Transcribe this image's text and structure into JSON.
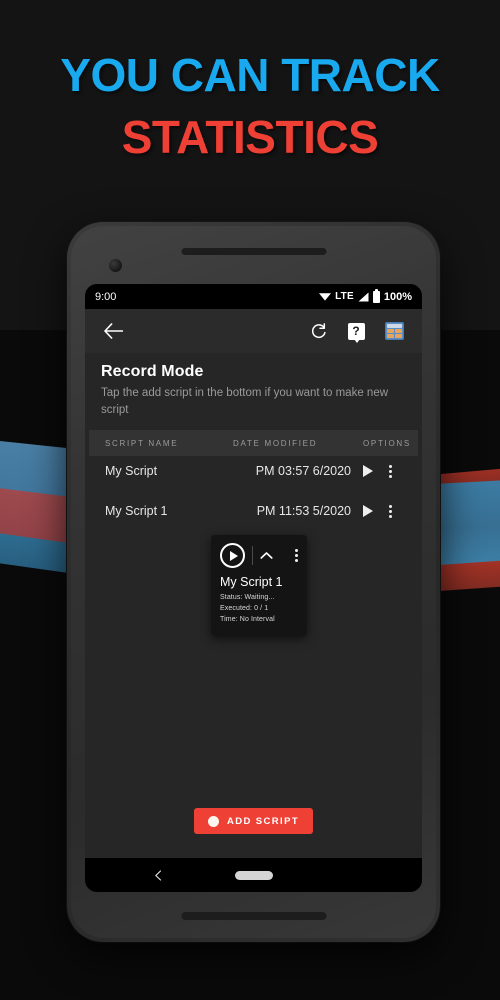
{
  "headline": {
    "line1": "YOU CAN TRACK",
    "line2": "STATISTICS",
    "color1": "#18a9ef",
    "color2": "#ef4036"
  },
  "status_bar": {
    "time": "9:00",
    "network": "LTE",
    "battery": "100%",
    "wifi_icon": "wifi-icon",
    "signal_icon": "signal-icon",
    "battery_icon": "battery-icon"
  },
  "toolbar": {
    "back_icon": "back-arrow-icon",
    "refresh_icon": "refresh-icon",
    "help_icon": "help-icon",
    "calculator_icon": "calculator-icon"
  },
  "page": {
    "title": "Record Mode",
    "subtitle": "Tap the add script in the bottom if you want to make new script"
  },
  "table": {
    "headers": {
      "name": "SCRIPT NAME",
      "date": "DATE MODIFIED",
      "options": "OPTIONS"
    },
    "rows": [
      {
        "name": "My Script",
        "date": "6/2020 03:57 PM",
        "play_icon": "play-icon",
        "menu_icon": "overflow-menu-icon"
      },
      {
        "name": "My Script 1",
        "date": "5/2020 11:53 PM",
        "play_icon": "play-icon",
        "menu_icon": "overflow-menu-icon"
      }
    ]
  },
  "widget": {
    "play_icon": "play-icon",
    "collapse_icon": "chevron-up-icon",
    "menu_icon": "overflow-menu-icon",
    "script_name": "My Script 1",
    "status": "Status: Waiting...",
    "executed": "Executed: 0 / 1",
    "time": "Time: No Interval"
  },
  "add_script": {
    "label": "ADD SCRIPT",
    "icon": "record-dot-icon",
    "color": "#ef4036"
  },
  "nav_bar": {
    "back_icon": "nav-back-icon",
    "home_icon": "nav-home-pill-icon"
  }
}
